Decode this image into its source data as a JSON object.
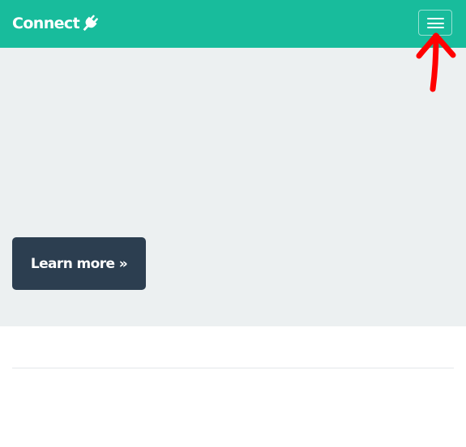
{
  "navbar": {
    "brand": "Connect",
    "brand_icon": "plug-icon",
    "toggle_icon": "hamburger-icon",
    "color": "#18bc9c"
  },
  "hero": {
    "background": "#ecf0f1",
    "cta_label": "Learn more »",
    "cta_color": "#2c3e50"
  },
  "annotation": {
    "icon": "arrow-up-icon",
    "color": "#ff0000"
  }
}
